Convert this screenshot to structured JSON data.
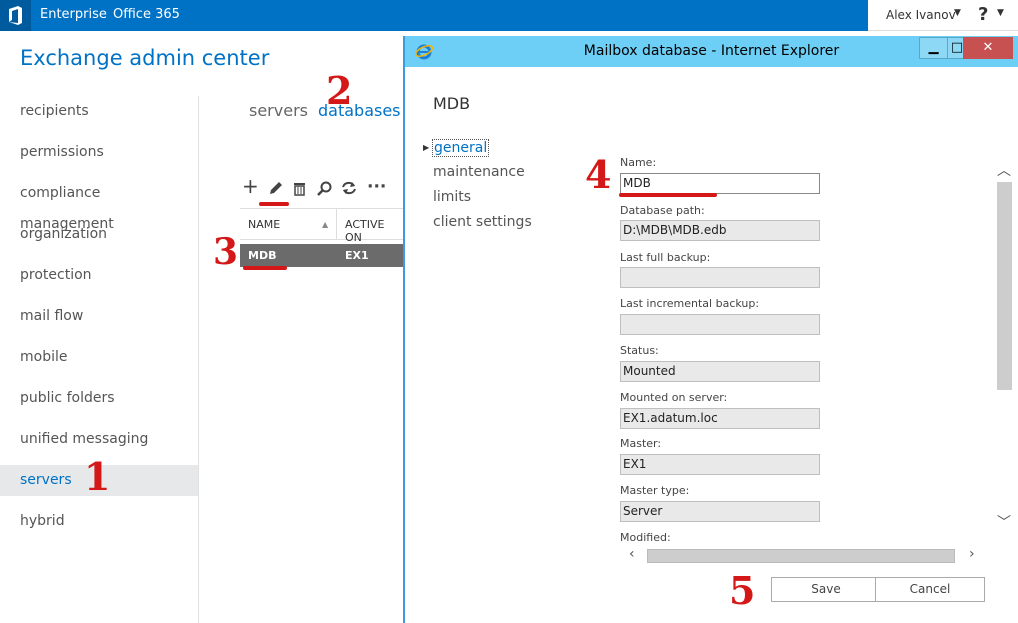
{
  "topbar": {
    "nav_enterprise": "Enterprise",
    "nav_office365": "Office 365",
    "user_name": "Alex Ivanov",
    "help_label": "?"
  },
  "app_title": "Exchange admin center",
  "leftnav": {
    "items": [
      "recipients",
      "permissions",
      "compliance management",
      "organization",
      "protection",
      "mail flow",
      "mobile",
      "public folders",
      "unified messaging",
      "servers",
      "hybrid"
    ],
    "selected": "servers"
  },
  "tabs": {
    "servers": "servers",
    "databases": "databases"
  },
  "toolbar": {
    "add_icon": "plus-icon",
    "edit_icon": "pencil-icon",
    "delete_icon": "trash-icon",
    "search_icon": "search-icon",
    "refresh_icon": "refresh-icon",
    "more_icon": "ellipsis-icon"
  },
  "table": {
    "columns": [
      "NAME",
      "ACTIVE ON"
    ],
    "rows": [
      {
        "name": "MDB",
        "active_on": "EX1"
      }
    ]
  },
  "annotations": [
    "1",
    "2",
    "3",
    "4",
    "5"
  ],
  "dialog": {
    "window_title": "Mailbox database - Internet Explorer",
    "heading": "MDB",
    "nav": [
      "general",
      "maintenance",
      "limits",
      "client settings"
    ],
    "selected_nav": "general",
    "fields": {
      "name_label": "Name:",
      "name_value": "MDB",
      "path_label": "Database path:",
      "path_value": "D:\\MDB\\MDB.edb",
      "full_backup_label": "Last full backup:",
      "full_backup_value": "",
      "incr_backup_label": "Last incremental backup:",
      "incr_backup_value": "",
      "status_label": "Status:",
      "status_value": "Mounted",
      "mounted_label": "Mounted on server:",
      "mounted_value": "EX1.adatum.loc",
      "master_label": "Master:",
      "master_value": "EX1",
      "master_type_label": "Master type:",
      "master_type_value": "Server",
      "modified_label": "Modified:"
    },
    "save_label": "Save",
    "cancel_label": "Cancel"
  },
  "colors": {
    "accent": "#0072c6",
    "annotation": "#d41818",
    "titlebar": "#6dcff6"
  }
}
